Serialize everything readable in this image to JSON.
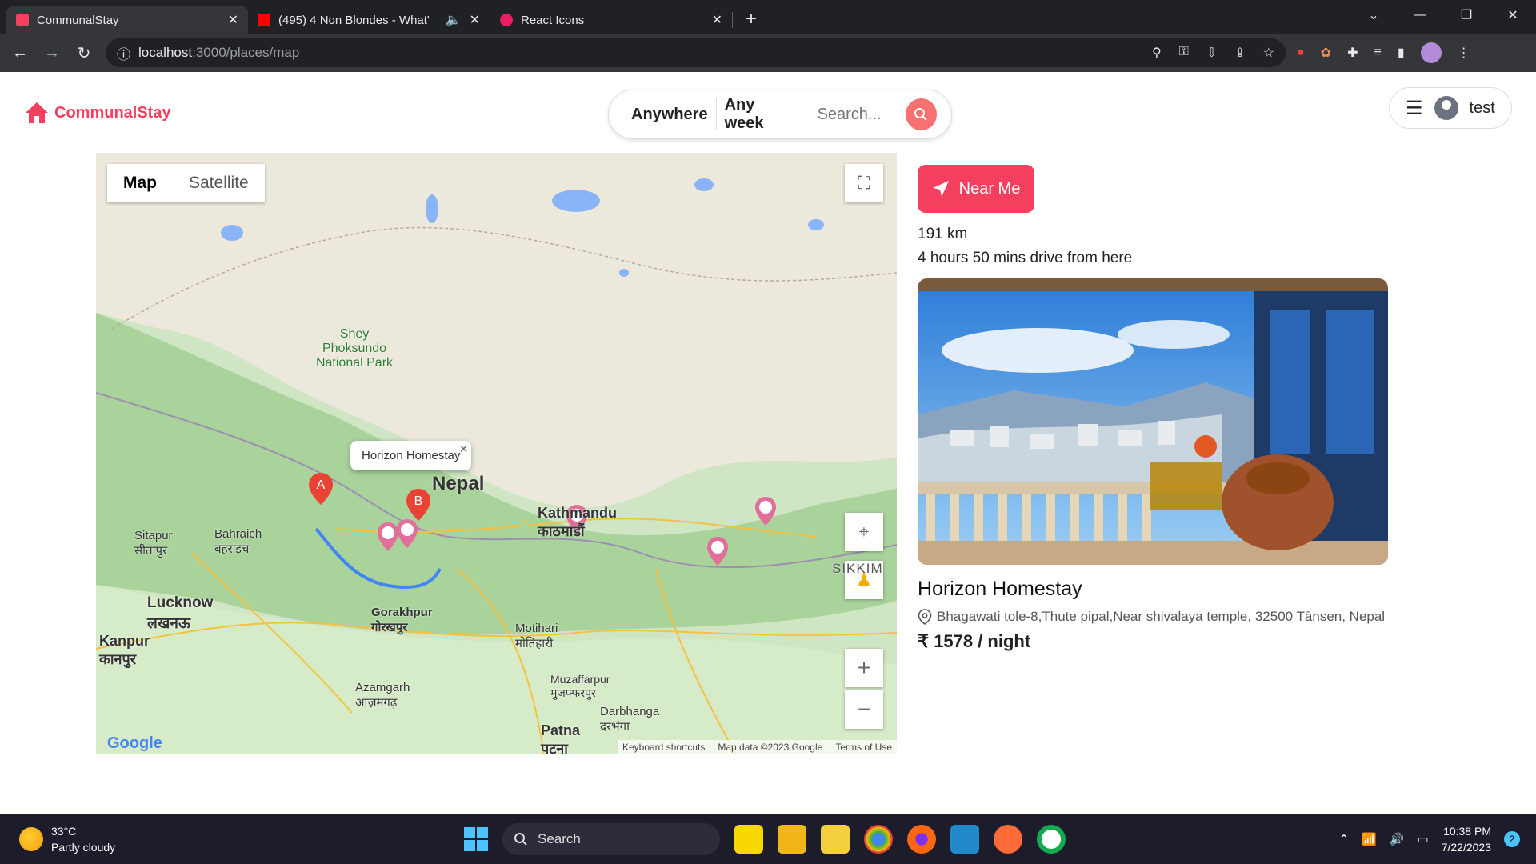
{
  "browser": {
    "tabs": [
      {
        "title": "CommunalStay",
        "color": "#f43f5e"
      },
      {
        "title": "(495) 4 Non Blondes - What'",
        "color": "#ff0000"
      },
      {
        "title": "React Icons",
        "color": "#e91e63"
      }
    ],
    "url_host": "localhost",
    "url_path": ":3000/places/map"
  },
  "header": {
    "brand": "CommunalStay",
    "search_anywhere": "Anywhere",
    "search_week": "Any week",
    "search_placeholder": "Search...",
    "username": "test"
  },
  "map": {
    "type_map": "Map",
    "type_satellite": "Satellite",
    "info_title": "Horizon Homestay",
    "marker_a": "A",
    "marker_b": "B",
    "footer_shortcuts": "Keyboard shortcuts",
    "footer_data": "Map data ©2023 Google",
    "footer_terms": "Terms of Use",
    "google": "Google",
    "labels": [
      {
        "text": "Lucknow\nलखनऊ"
      },
      {
        "text": "Kanpur\nकानपुर"
      },
      {
        "text": "Gorakhpur\nगोरखपुर"
      },
      {
        "text": "Kathmandu\nकाठमाडौं"
      },
      {
        "text": "Patna\nपटना"
      },
      {
        "text": "SIKKIM"
      },
      {
        "text": "Nepal"
      },
      {
        "text": "Shey Phoksundo National Park"
      },
      {
        "text": "Motihari\nमोतिहारी"
      },
      {
        "text": "Muzaffarpur\nमुजफ्फरपुर"
      },
      {
        "text": "Darbhanga\nदरभंगा"
      },
      {
        "text": "Azamgarh\nआज़मगढ़"
      },
      {
        "text": "Bahraich\nबहराइच"
      },
      {
        "text": "Sitapur\nसीतापुर"
      }
    ]
  },
  "place": {
    "near_me": "Near Me",
    "distance": "191 km",
    "duration": "4 hours 50 mins drive from here",
    "title": "Horizon Homestay",
    "address": "Bhagawati tole-8,Thute pipal,Near shivalaya temple, 32500 Tānsen, Nepal",
    "price": "₹ 1578 / night"
  },
  "taskbar": {
    "temp": "33°C",
    "weather": "Partly cloudy",
    "search": "Search",
    "time": "10:38 PM",
    "date": "7/22/2023",
    "notifications": "2"
  }
}
